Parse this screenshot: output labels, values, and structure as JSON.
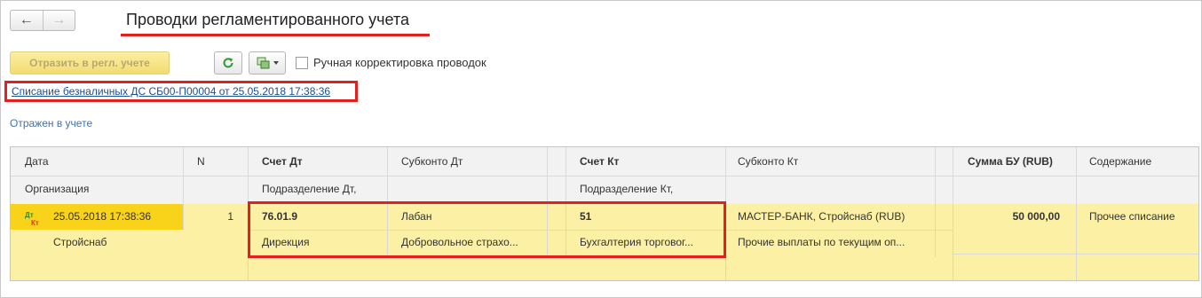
{
  "window": {
    "title": "Проводки регламентированного учета",
    "nav_back": "←",
    "nav_forward": "→"
  },
  "toolbar": {
    "post_button": "Отразить в регл. учете",
    "refresh_icon": "refresh-icon",
    "copy_icon": "copy-icon",
    "manual_checkbox_label": "Ручная корректировка проводок",
    "manual_checked": false
  },
  "document": {
    "link": "Списание безналичных ДС СБ00-П00004 от 25.05.2018 17:38:36",
    "status": "Отражен в учете"
  },
  "table": {
    "headers": {
      "date": "Дата",
      "n": "N",
      "debit_account": "Счет Дт",
      "debit_subconto": "Субконто Дт",
      "credit_account": "Счет Кт",
      "credit_subconto": "Субконто Кт",
      "amount": "Сумма БУ (RUB)",
      "content": "Содержание",
      "organization": "Организация",
      "debit_division": "Подразделение Дт,",
      "credit_division": "Подразделение Кт,"
    },
    "rows": [
      {
        "icon_dt": "Дт",
        "icon_kt": "Кт",
        "date": "25.05.2018 17:38:36",
        "n": "1",
        "debit_account": "76.01.9",
        "debit_subconto": "Лабан",
        "credit_account": "51",
        "credit_subconto": "МАСТЕР-БАНК, Стройснаб (RUB)",
        "amount": "50 000,00",
        "content": "Прочее списание",
        "organization": "Стройснаб",
        "debit_division": "Дирекция",
        "debit_subconto_2": "Добровольное страхо...",
        "credit_division": "Бухгалтерия торговог...",
        "credit_subconto_2": "Прочие выплаты по текущим оп..."
      }
    ]
  },
  "colors": {
    "accent_red": "#e4201f",
    "row_yellow": "#fbf0a4",
    "selection_yellow": "#f9d21a",
    "link_blue": "#1a4f8f"
  }
}
